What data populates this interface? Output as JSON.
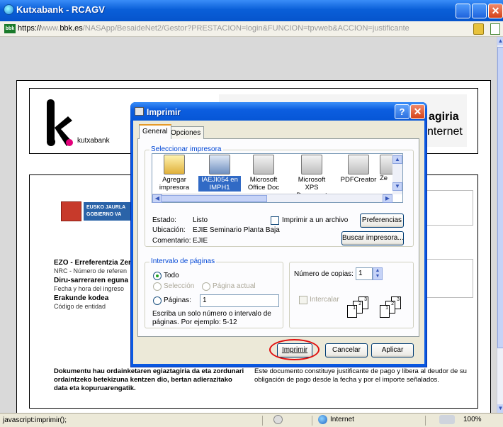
{
  "browser": {
    "title": "Kutxabank - RCAGV",
    "url_scheme": "https://",
    "url_prefix": "www.",
    "url_domain": "bbk.es",
    "url_path": "/NASApp/BesaideNet2/Gestor?PRESTACION=login&FUNCION=tpvweb&ACCION=justificante",
    "favicon_text": "bbk",
    "status_text": "javascript:imprimir();",
    "zone": "Internet",
    "zoom": "100%"
  },
  "page": {
    "bank_name": "kutxabank",
    "header_right_line1": "agiria",
    "header_right_line2": "nternet",
    "gov_logo_text": "EUSKO JAURLA GOBIERNO VA",
    "fields": [
      {
        "label": "EZO - Erreferentzia Zen",
        "bold": true
      },
      {
        "label": "NRC - Número de referen",
        "bold": false
      },
      {
        "label": "Diru-sarreraren eguna",
        "bold": true
      },
      {
        "label": "Fecha y hora del ingreso",
        "bold": false
      },
      {
        "label": "Erakunde kodea",
        "bold": true
      },
      {
        "label": "Código de entidad",
        "bold": false
      }
    ],
    "footer_eu": "Dokumentu hau ordainketaren egiaztagiria da eta zordunari ordaintzeko betekizuna kentzen dio, bertan adierazitako data eta kopuruarengatik.",
    "footer_es": "Este documento constituye justificante de pago y libera al deudor de su obligación de pago desde la fecha y por el importe señalados."
  },
  "dialog": {
    "title": "Imprimir",
    "help_glyph": "?",
    "close_glyph": "✕",
    "tabs": [
      "General",
      "Opciones"
    ],
    "select_printer_title": "Seleccionar impresora",
    "printers": [
      "Agregar impresora",
      "IAEJI054 en IMPH1",
      "Microsoft Office Doc",
      "Microsoft XPS Document",
      "PDFCreator",
      "Ze"
    ],
    "estado_label": "Estado:",
    "estado_value": "Listo",
    "ubicacion_label": "Ubicación:",
    "ubicacion_value": "EJIE Seminario Planta Baja",
    "comentario_label": "Comentario:",
    "comentario_value": "EJIE",
    "print_to_file": "Imprimir a un archivo",
    "preferences_btn": "Preferencias",
    "find_printer_btn": "Buscar impresora...",
    "range_title": "Intervalo de páginas",
    "range_all": "Todo",
    "range_selection": "Selección",
    "range_current": "Página actual",
    "range_pages": "Páginas:",
    "pages_value": "1",
    "range_hint": "Escriba un solo número o intervalo de páginas. Por ejemplo: 5-12",
    "copies_label": "Número de copias:",
    "copies_value": "1",
    "collate_label": "Intercalar",
    "print_btn": "Imprimir",
    "cancel_btn": "Cancelar",
    "apply_btn": "Aplicar"
  }
}
